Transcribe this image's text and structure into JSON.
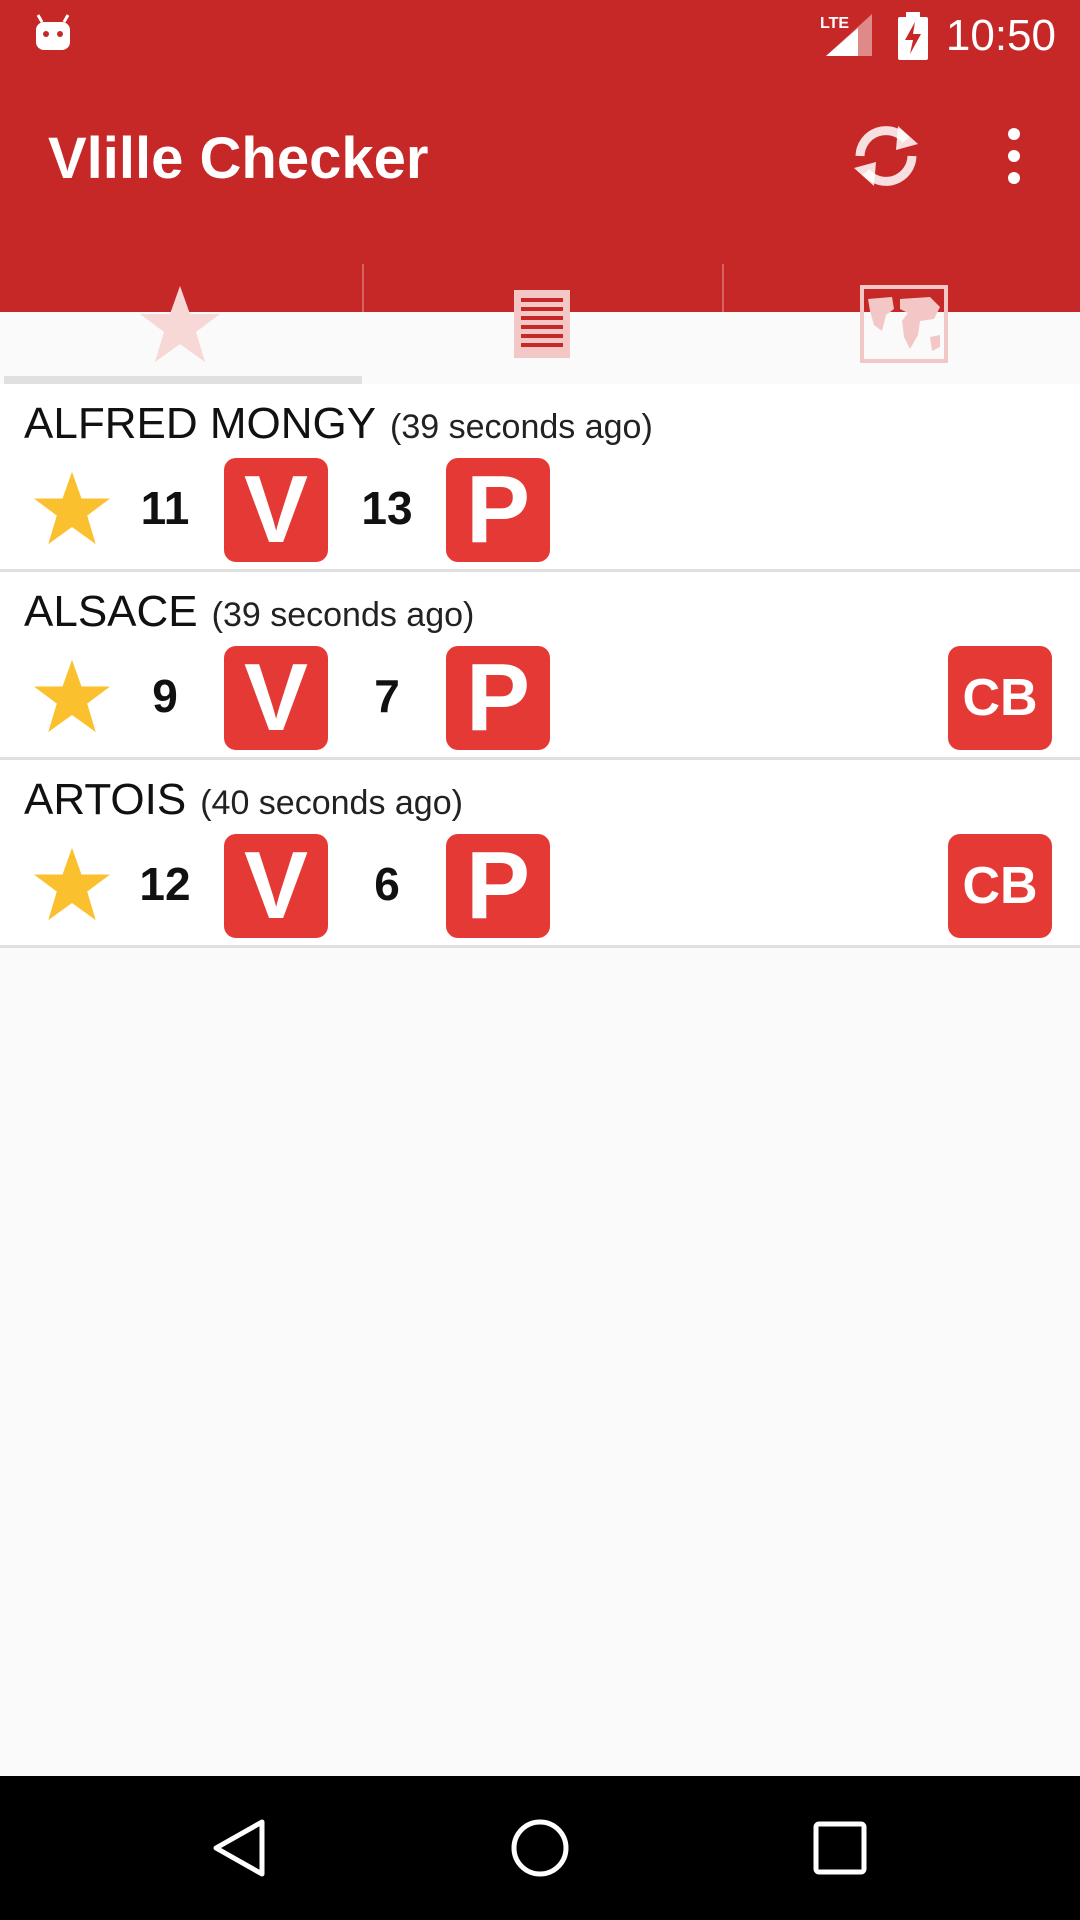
{
  "status_bar": {
    "network": "LTE",
    "time": "10:50"
  },
  "app_bar": {
    "title": "Vlille Checker"
  },
  "tabs": [
    {
      "icon": "star-icon",
      "selected": true
    },
    {
      "icon": "list-icon",
      "selected": false
    },
    {
      "icon": "map-icon",
      "selected": false
    }
  ],
  "stations": [
    {
      "name": "ALFRED MONGY",
      "updated": "(39 seconds ago)",
      "bikes": "11",
      "bike_label": "V",
      "slots": "13",
      "slot_label": "P",
      "card_payment": false,
      "favorite": true
    },
    {
      "name": "ALSACE",
      "updated": "(39 seconds ago)",
      "bikes": "9",
      "bike_label": "V",
      "slots": "7",
      "slot_label": "P",
      "card_payment": true,
      "card_label": "CB",
      "favorite": true
    },
    {
      "name": "ARTOIS",
      "updated": "(40 seconds ago)",
      "bikes": "12",
      "bike_label": "V",
      "slots": "6",
      "slot_label": "P",
      "card_payment": true,
      "card_label": "CB",
      "favorite": true
    }
  ],
  "colors": {
    "primary": "#c62828",
    "badge": "#e53935",
    "star": "#fbc02d"
  }
}
